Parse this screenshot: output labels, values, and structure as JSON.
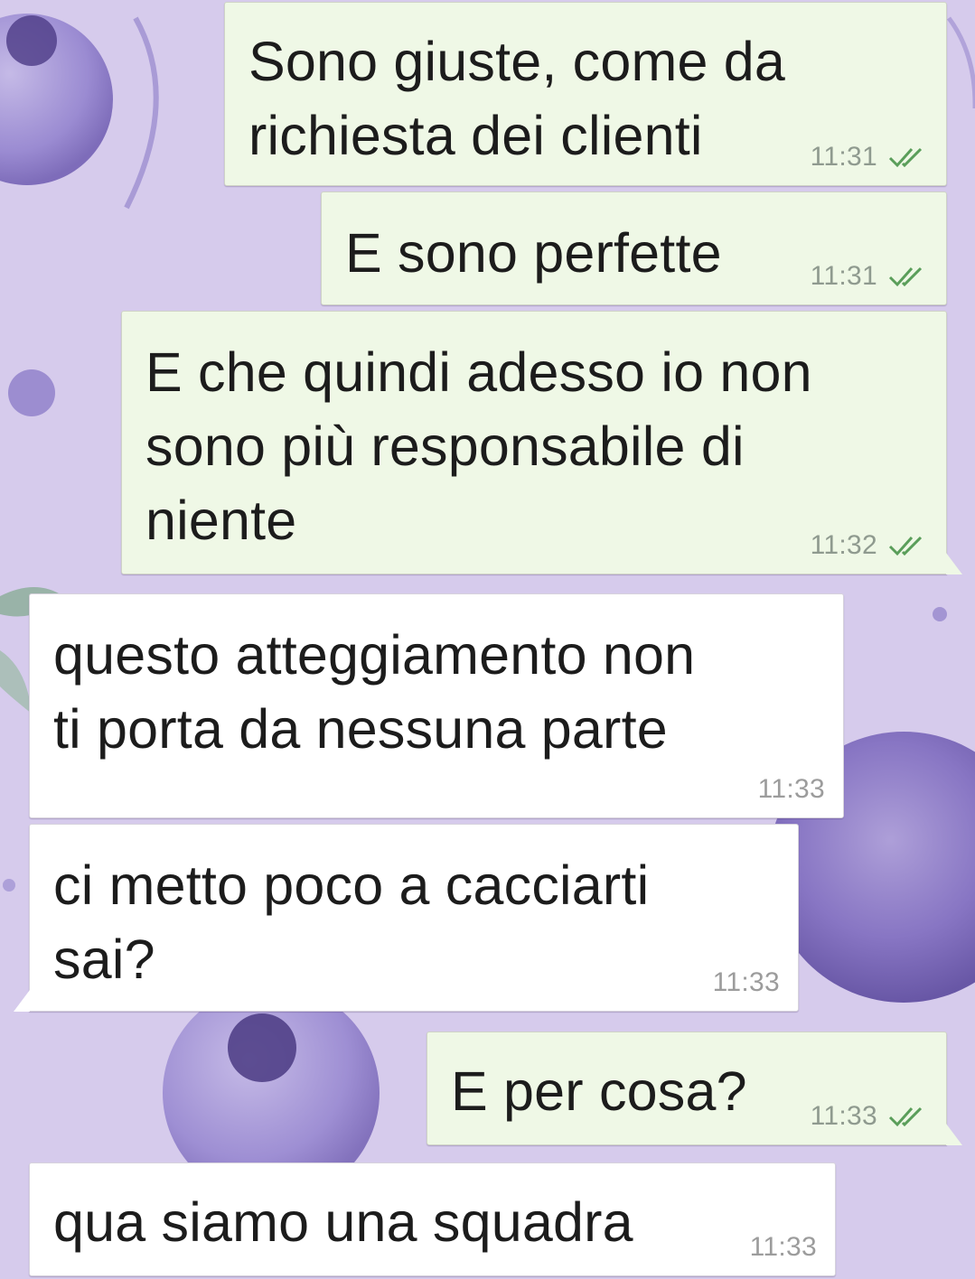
{
  "chat": {
    "messages": [
      {
        "direction": "out",
        "text": "Sono giuste, come da\nrichiesta dei clienti",
        "time": "11:31",
        "status": "double-check-icon"
      },
      {
        "direction": "out",
        "text": "E sono perfette",
        "time": "11:31",
        "status": "double-check-icon"
      },
      {
        "direction": "out",
        "text": "E che quindi adesso io non\nsono più responsabile di\nniente",
        "time": "11:32",
        "status": "double-check-icon"
      },
      {
        "direction": "in",
        "text": "questo atteggiamento non\nti porta da nessuna parte",
        "time": "11:33"
      },
      {
        "direction": "in",
        "text": "ci metto poco a cacciarti\nsai?",
        "time": "11:33"
      },
      {
        "direction": "out",
        "text": "E per cosa?",
        "time": "11:33",
        "status": "double-check-icon"
      },
      {
        "direction": "in",
        "text": "qua siamo una squadra",
        "time": "11:33"
      }
    ]
  },
  "colors": {
    "outgoing_bubble": "#eff8e6",
    "incoming_bubble": "#ffffff",
    "tick_color": "#5a9e5a",
    "wallpaper": "#d4c8ea"
  }
}
